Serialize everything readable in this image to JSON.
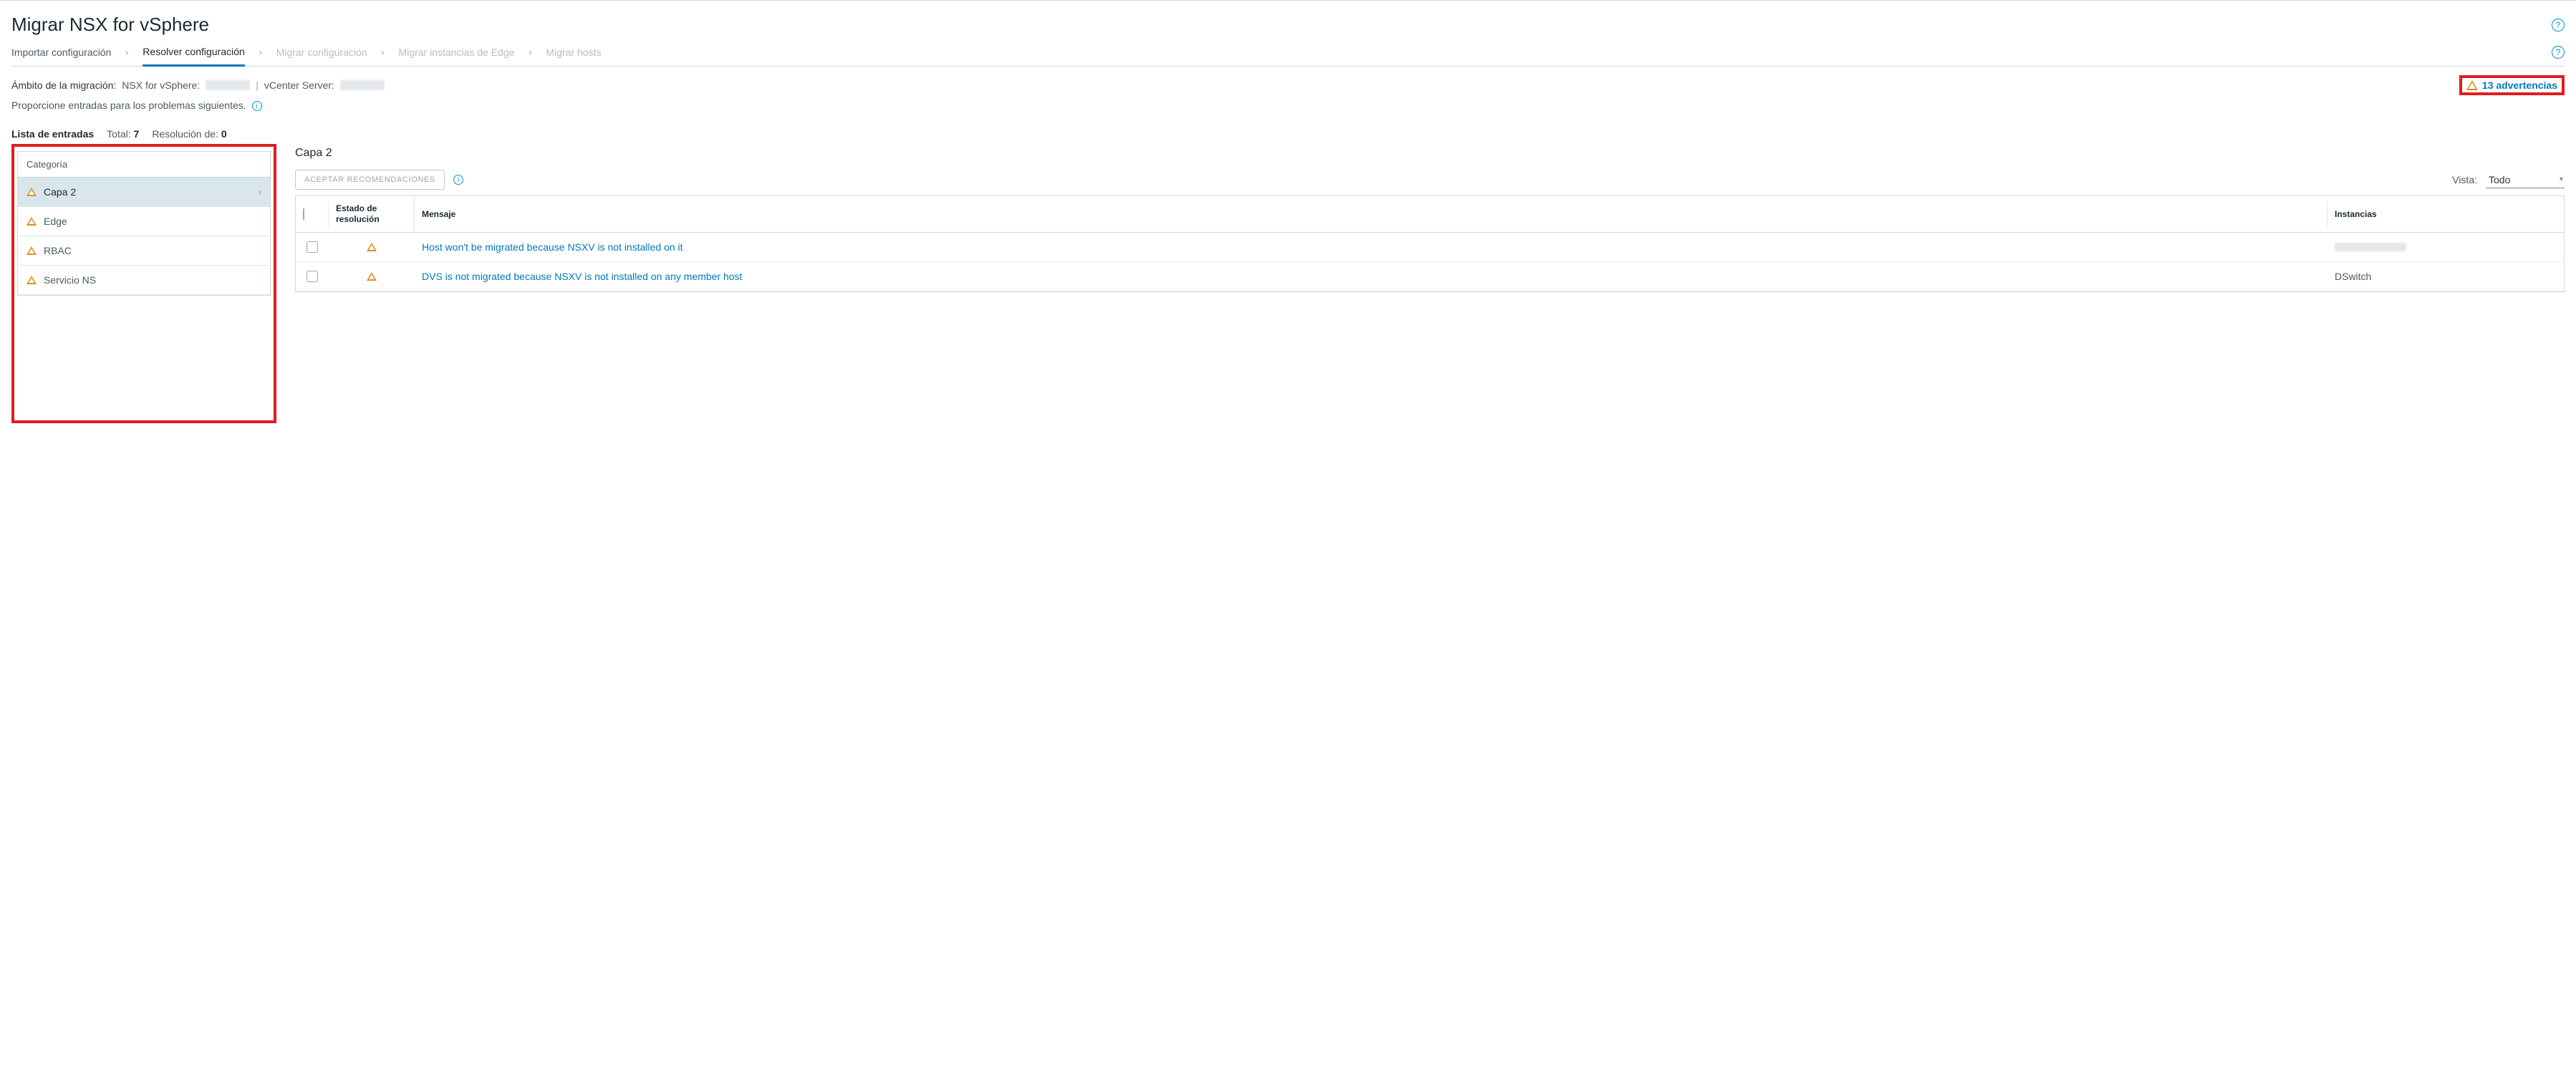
{
  "title": "Migrar NSX for vSphere",
  "steps": {
    "import": "Importar configuración",
    "resolve": "Resolver configuración",
    "migrate_config": "Migrar configuración",
    "migrate_edge": "Migrar instancias de Edge",
    "migrate_hosts": "Migrar hosts"
  },
  "scope": {
    "label": "Ámbito de la migración:",
    "nsx_key": "NSX for vSphere:",
    "vcenter_key": "vCenter Server:"
  },
  "warnings": {
    "text": "13 advertencias"
  },
  "instruction": "Proporcione entradas para los problemas siguientes.",
  "list": {
    "title": "Lista de entradas",
    "total_label": "Total:",
    "total_value": "7",
    "resolved_label": "Resolución de:",
    "resolved_value": "0"
  },
  "sidebar": {
    "header": "Categoría",
    "items": [
      {
        "label": "Capa 2"
      },
      {
        "label": "Edge"
      },
      {
        "label": "RBAC"
      },
      {
        "label": "Servicio NS"
      }
    ]
  },
  "main": {
    "heading": "Capa 2",
    "accept_button": "ACEPTAR RECOMENDACIONES",
    "view_label": "Vista:",
    "view_value": "Todo",
    "columns": {
      "status": "Estado de resolución",
      "message": "Mensaje",
      "instances": "Instancias"
    },
    "rows": [
      {
        "message": "Host won't be migrated because NSXV is not installed on it",
        "instance": ""
      },
      {
        "message": "DVS is not migrated because NSXV is not installed on any member host",
        "instance": "DSwitch"
      }
    ]
  }
}
